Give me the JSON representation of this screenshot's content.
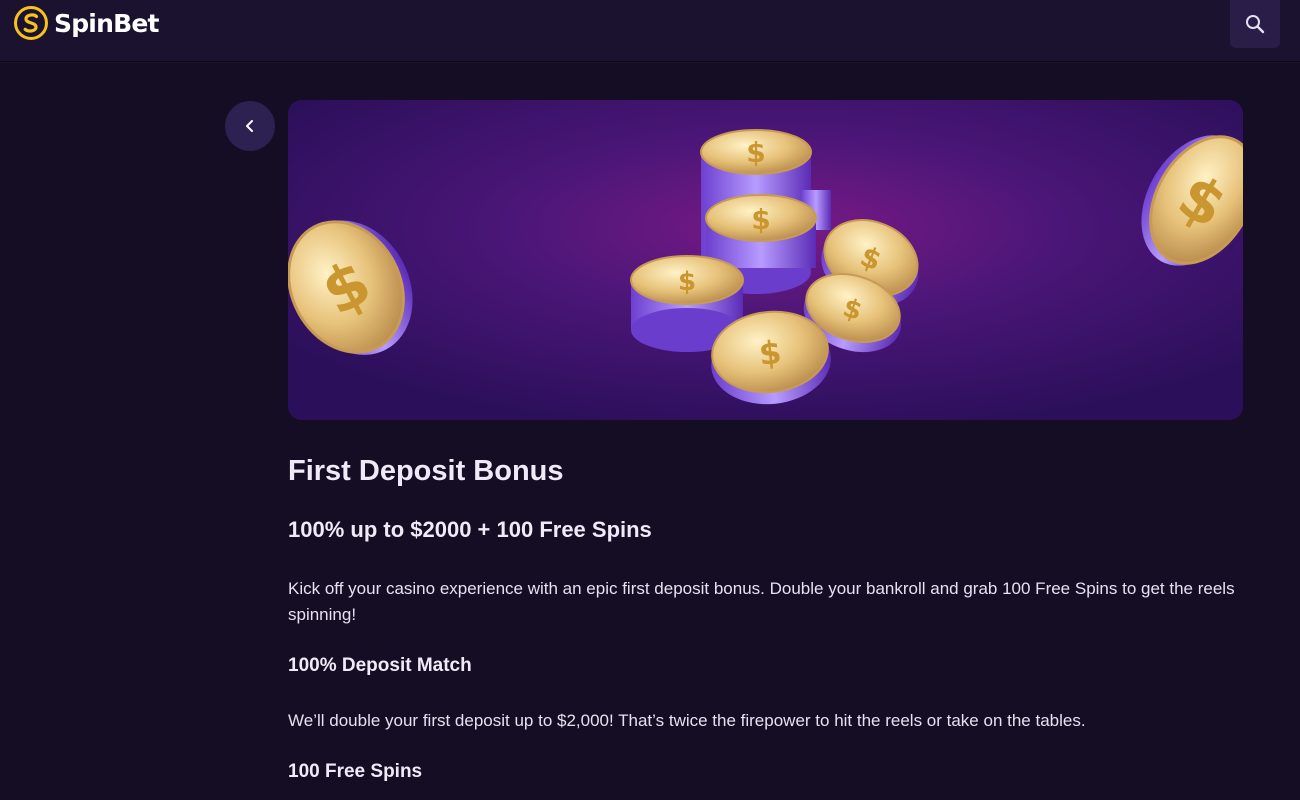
{
  "header": {
    "brand_name": "SpinBet",
    "logo_icon": "spinbet-coin-logo",
    "search_icon": "search-icon"
  },
  "navigation": {
    "back_icon": "chevron-left-icon"
  },
  "banner": {
    "image": "stacked gold dollar coins on purple background"
  },
  "promo": {
    "title": "First Deposit Bonus",
    "headline": "100% up to $2000 + 100 Free Spins",
    "intro": "Kick off your casino experience with an epic first deposit bonus. Double your bankroll and grab 100 Free Spins to get the reels spinning!",
    "sections": [
      {
        "heading": "100% Deposit Match",
        "body": "We’ll double your first deposit up to $2,000! That’s twice the firepower to hit the reels or take on the tables."
      },
      {
        "heading": "100 Free Spins"
      }
    ]
  },
  "colors": {
    "page_background": "#140d24",
    "header_background": "#1b1230",
    "brand_yellow": "#f6c21c",
    "banner_purple": "#3a1469",
    "coin_gold": "#e9c57a",
    "coin_edge": "#8b5cf6"
  }
}
